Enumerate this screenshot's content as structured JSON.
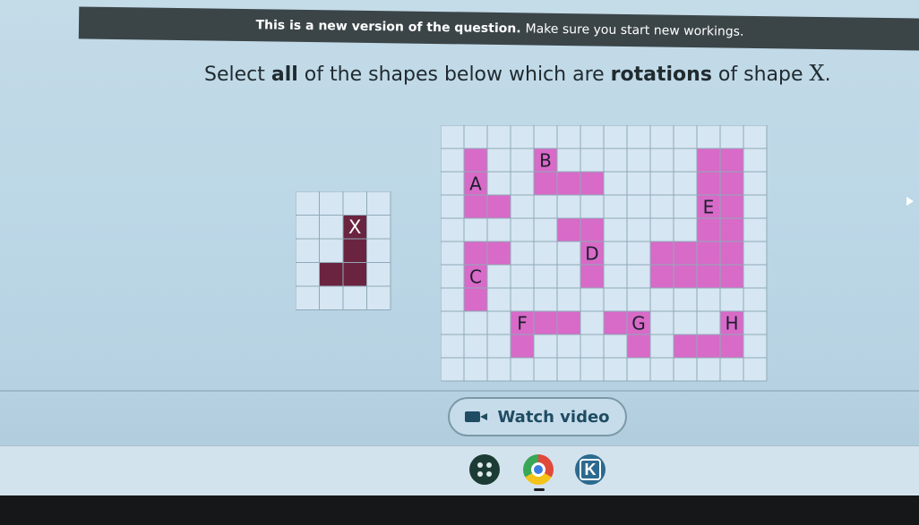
{
  "banner": {
    "bold_text": "This is a new version of the question.",
    "rest_text": "Make sure you start new workings."
  },
  "question": {
    "prefix": "Select ",
    "all_word": "all",
    "middle": " of the shapes below which are ",
    "rotations_word": "rotations",
    "suffix_before_x": " of shape ",
    "x_label": "X",
    "period": "."
  },
  "reference_grid": {
    "cols": 4,
    "rows": 5,
    "shape": {
      "label": "X",
      "color": "#6b2440",
      "cells": [
        [
          2,
          1
        ],
        [
          2,
          2
        ],
        [
          2,
          3
        ],
        [
          1,
          3
        ]
      ]
    }
  },
  "options_grid": {
    "cols": 14,
    "rows": 11,
    "shapes": [
      {
        "label": "A",
        "color": "#d86ac8",
        "cells": [
          [
            1,
            1
          ],
          [
            1,
            2
          ],
          [
            1,
            3
          ],
          [
            2,
            3
          ]
        ],
        "label_cell": [
          1,
          2
        ]
      },
      {
        "label": "B",
        "color": "#d86ac8",
        "cells": [
          [
            4,
            1
          ],
          [
            5,
            2
          ],
          [
            6,
            2
          ],
          [
            4,
            2
          ]
        ],
        "label_cell": [
          4,
          1
        ]
      },
      {
        "label": "C",
        "color": "#d86ac8",
        "cells": [
          [
            1,
            5
          ],
          [
            2,
            5
          ],
          [
            1,
            6
          ],
          [
            1,
            7
          ]
        ],
        "label_cell": [
          1,
          6
        ]
      },
      {
        "label": "D",
        "color": "#d86ac8",
        "cells": [
          [
            5,
            4
          ],
          [
            6,
            4
          ],
          [
            6,
            5
          ],
          [
            6,
            6
          ]
        ],
        "label_cell": [
          6,
          5
        ]
      },
      {
        "label": "E",
        "color": "#d86ac8",
        "cells": [
          [
            11,
            1
          ],
          [
            12,
            1
          ],
          [
            11,
            2
          ],
          [
            12,
            2
          ],
          [
            11,
            3
          ],
          [
            12,
            3
          ],
          [
            11,
            4
          ],
          [
            12,
            4
          ],
          [
            9,
            5
          ],
          [
            10,
            5
          ],
          [
            11,
            5
          ],
          [
            12,
            5
          ],
          [
            9,
            6
          ],
          [
            10,
            6
          ],
          [
            11,
            6
          ],
          [
            12,
            6
          ]
        ],
        "label_cell": [
          11,
          3
        ]
      },
      {
        "label": "F",
        "color": "#d86ac8",
        "cells": [
          [
            3,
            8
          ],
          [
            4,
            8
          ],
          [
            5,
            8
          ],
          [
            3,
            9
          ]
        ],
        "label_cell": [
          3,
          8
        ]
      },
      {
        "label": "G",
        "color": "#d86ac8",
        "cells": [
          [
            7,
            8
          ],
          [
            8,
            8
          ],
          [
            8,
            9
          ]
        ],
        "label_cell": [
          8,
          8
        ]
      },
      {
        "label": "H",
        "color": "#d86ac8",
        "cells": [
          [
            10,
            9
          ],
          [
            11,
            9
          ],
          [
            12,
            9
          ],
          [
            12,
            8
          ]
        ],
        "label_cell": [
          12,
          8
        ]
      }
    ]
  },
  "video_button": {
    "label": "Watch video",
    "icon": "video-camera-icon"
  },
  "taskbar": {
    "launcher_icon": "launcher-icon",
    "browser_icon": "chrome-icon",
    "app_icon": "k-app-icon",
    "app_letter": "K"
  },
  "colors": {
    "banner": "#3b4548",
    "shape_x": "#6b2440",
    "shapes": "#d86ac8",
    "text": "#202b30"
  }
}
